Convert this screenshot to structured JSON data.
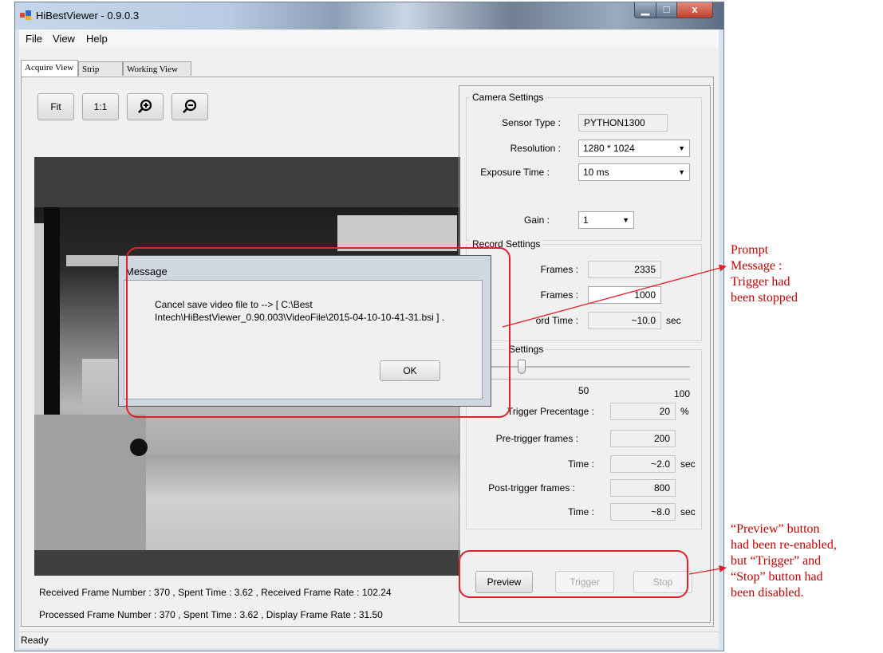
{
  "window": {
    "title": "HiBestViewer - 0.9.0.3",
    "min": "▁",
    "max": "□",
    "close": "x"
  },
  "menu": [
    "File",
    "View",
    "Help"
  ],
  "tabs": [
    "Acquire View",
    "Strip View",
    "Working View"
  ],
  "toolbar": {
    "fit": "Fit",
    "one_to_one": "1:1",
    "zoom_in_icon": "zoom-in",
    "zoom_out_icon": "zoom-out"
  },
  "stats": {
    "received": "Received Frame Number : 370 , Spent Time : 3.62 , Received Frame Rate : 102.24",
    "processed": "Processed Frame Number : 370 , Spent Time : 3.62 ,  Display Frame Rate : 31.50"
  },
  "camera": {
    "title": "Camera Settings",
    "sensor_label": "Sensor Type :",
    "sensor_value": "PYTHON1300",
    "resolution_label": "Resolution :",
    "resolution_value": "1280 * 1024",
    "exposure_label": "Exposure Time :",
    "exposure_value": "10 ms",
    "gain_label": "Gain :",
    "gain_value": "1"
  },
  "record": {
    "title": "Record Settings",
    "max_label": "Frames :",
    "max_value": "2335",
    "rec_label": "Frames :",
    "rec_value": "1000",
    "time_label": "ord Time :",
    "time_value": "~10.0",
    "time_unit": "sec"
  },
  "trigger": {
    "title": "Settings",
    "slider_fraction": 0.2,
    "tick_mid": "50",
    "tick_max": "100",
    "pct_label": "Trigger Precentage :",
    "pct_value": "20",
    "pct_unit": "%",
    "pre_label": "Pre-trigger frames :",
    "pre_value": "200",
    "pre_time_label": "Time :",
    "pre_time_value": "~2.0",
    "pre_time_unit": "sec",
    "post_label": "Post-trigger frames :",
    "post_value": "800",
    "post_time_label": "Time :",
    "post_time_value": "~8.0",
    "post_time_unit": "sec"
  },
  "actions": {
    "preview": "Preview",
    "trigger": "Trigger",
    "stop": "Stop"
  },
  "status": "Ready",
  "dialog": {
    "title": "Message",
    "message": "Cancel save video file to --> [ C:\\Best Intech\\HiBestViewer_0.90.003\\VideoFile\\2015-04-10-10-41-31.bsi ] .",
    "ok": "OK"
  },
  "annotations": {
    "prompt": [
      "Prompt",
      "Message :",
      "Trigger  had",
      "been stopped"
    ],
    "buttons": [
      "“Preview” button",
      "had been re-enabled,",
      "but “Trigger”  and",
      "“Stop” button had",
      "been disabled."
    ]
  },
  "colors": {
    "annotation": "#c00000",
    "ring": "#e0202a"
  }
}
